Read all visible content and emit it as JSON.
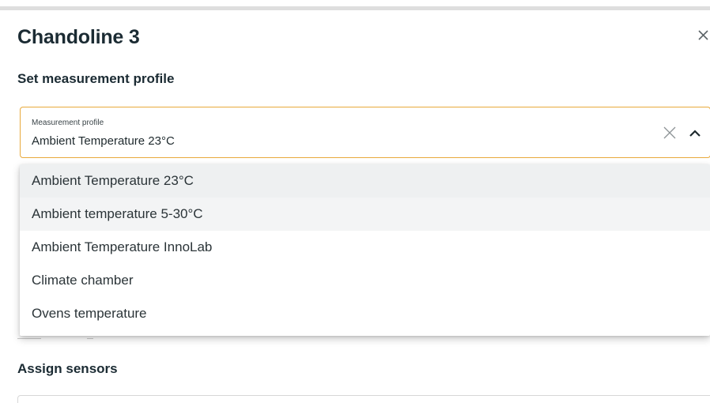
{
  "dialog": {
    "title": "Chandoline 3",
    "close_icon": "close-icon"
  },
  "profile_section": {
    "heading": "Set measurement profile",
    "select": {
      "label": "Measurement profile",
      "value": "Ambient Temperature 23°C",
      "clear_icon": "close-icon",
      "toggle_icon": "chevron-up-icon",
      "border_color": "#e8a93b"
    },
    "options": [
      {
        "label": "Ambient Temperature 23°C",
        "selected": true
      },
      {
        "label": "Ambient temperature 5-30°C",
        "selected": false
      },
      {
        "label": "Ambient Temperature InnoLab",
        "selected": false
      },
      {
        "label": "Climate chamber",
        "selected": false
      },
      {
        "label": "Ovens temperature",
        "selected": false
      }
    ]
  },
  "sensors_section": {
    "heading": "Assign sensors"
  }
}
